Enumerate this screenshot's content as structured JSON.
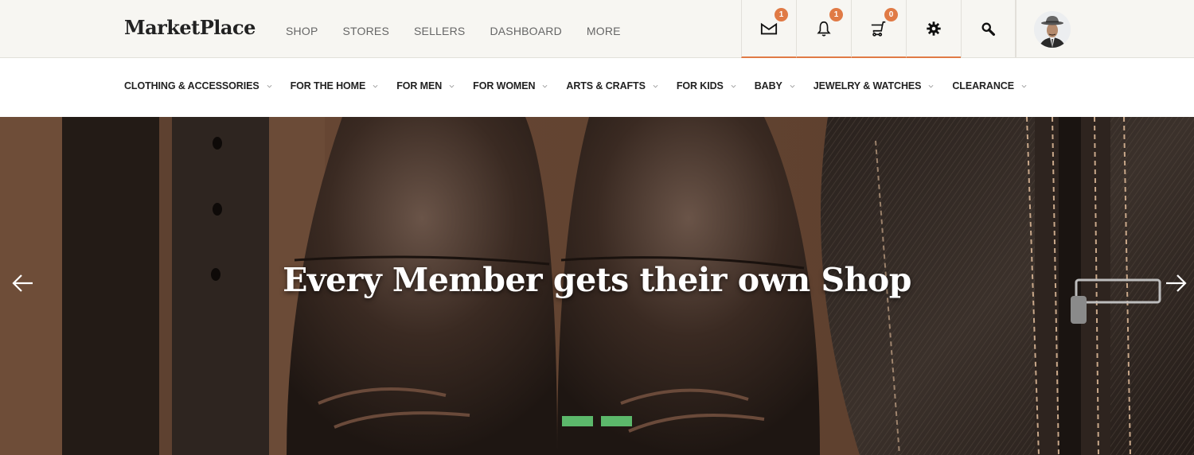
{
  "header": {
    "logo": "MarketPlace",
    "nav": [
      "SHOP",
      "STORES",
      "SELLERS",
      "DASHBOARD",
      "MORE"
    ],
    "icons": [
      {
        "name": "mail-icon",
        "badge": "1"
      },
      {
        "name": "bell-icon",
        "badge": "1"
      },
      {
        "name": "cart-icon",
        "badge": "0"
      },
      {
        "name": "gear-icon",
        "badge": null
      },
      {
        "name": "search-icon",
        "badge": null
      }
    ],
    "accent_color": "#e07a45"
  },
  "categories": [
    "CLOTHING & ACCESSORIES",
    "FOR THE HOME",
    "FOR MEN",
    "FOR WOMEN",
    "ARTS & CRAFTS",
    "FOR KIDS",
    "BABY",
    "JEWELRY & WATCHES",
    "CLEARANCE"
  ],
  "hero": {
    "title": "Every Member gets their own Shop",
    "slides": 2,
    "indicator_color": "#5cb86b"
  }
}
